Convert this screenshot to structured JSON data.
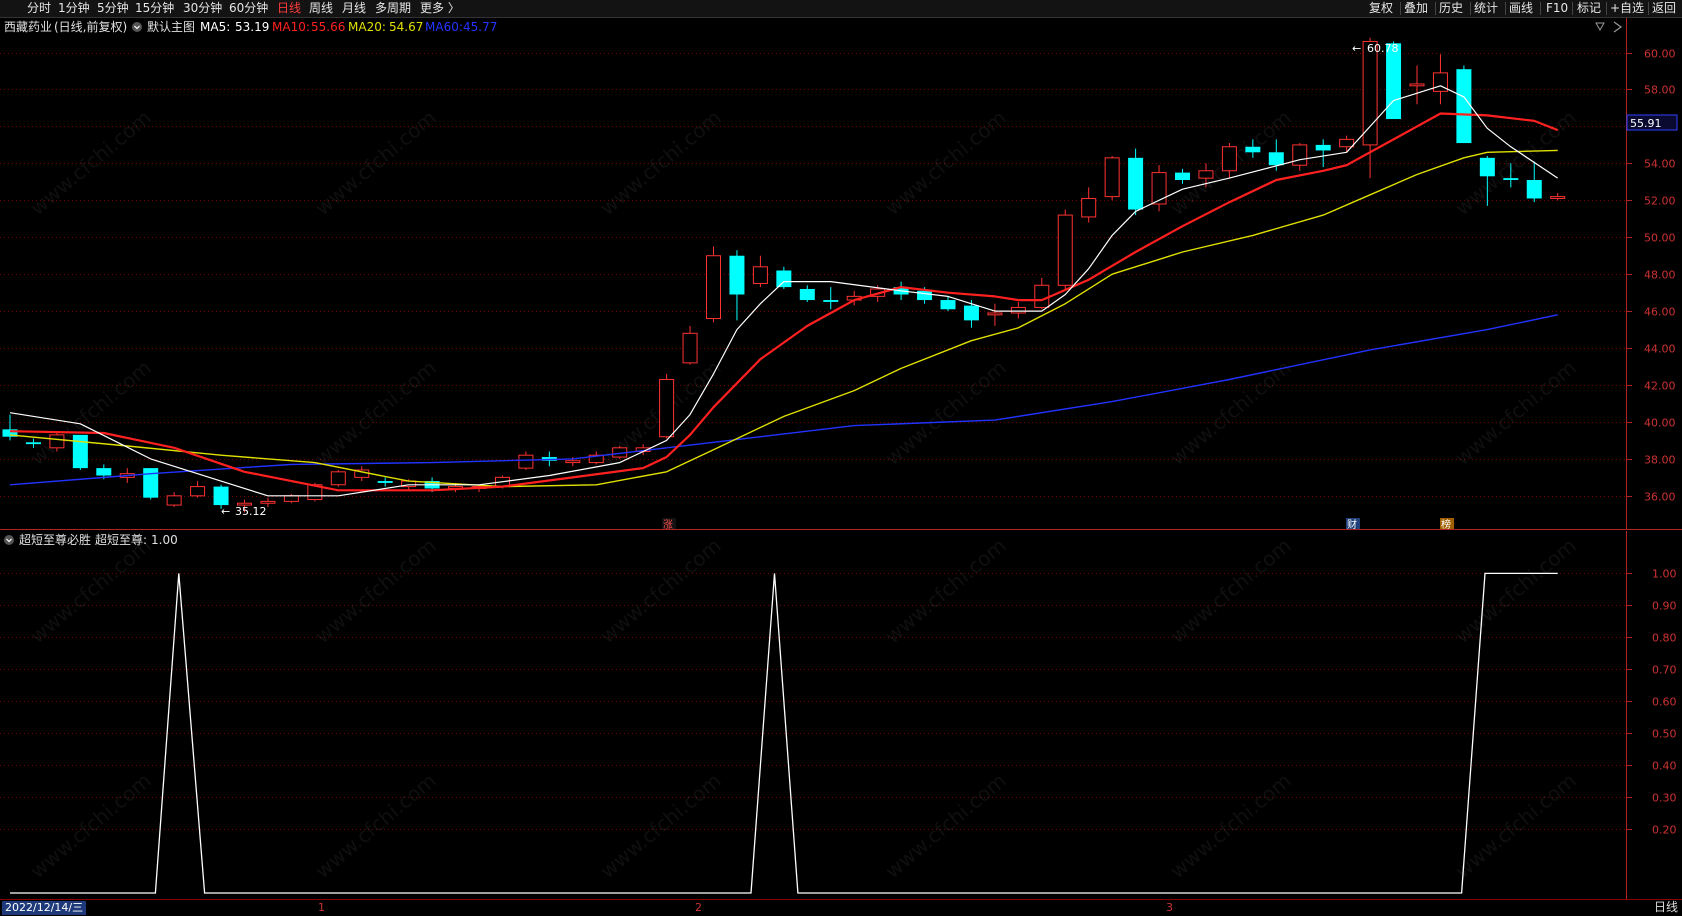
{
  "toolbar": {
    "left_items": [
      "分时",
      "1分钟",
      "5分钟",
      "15分钟",
      "30分钟",
      "60分钟",
      "日线",
      "周线",
      "月线",
      "多周期",
      "更多"
    ],
    "active_index": 6,
    "more_arrow": "〉",
    "right_items": [
      "复权",
      "叠加",
      "历史",
      "统计",
      "画线",
      "F10",
      "标记",
      "+自选",
      "返回"
    ]
  },
  "main_legend": {
    "stock_name": "西藏药业",
    "mode": "(日线,前复权)",
    "template": "默认主图",
    "ma5_label": "MA5:",
    "ma5_value": "53.19",
    "ma10_label": "MA10:",
    "ma10_value": "55.66",
    "ma20_label": "MA20:",
    "ma20_value": "54.67",
    "ma60_label": "MA60:",
    "ma60_value": "45.77"
  },
  "indicator_legend": {
    "name": "超短至尊必胜",
    "series_label": "超短至尊:",
    "series_value": "1.00"
  },
  "price_axis": {
    "ticks": [
      "60.00",
      "58.00",
      "56.00",
      "54.00",
      "52.00",
      "50.00",
      "48.00",
      "46.00",
      "44.00",
      "42.00",
      "40.00",
      "38.00",
      "36.00"
    ],
    "current_price": "55.91"
  },
  "indicator_axis": {
    "ticks": [
      "1.00",
      "0.90",
      "0.80",
      "0.70",
      "0.60",
      "0.50",
      "0.40",
      "0.30",
      "0.20"
    ]
  },
  "annotations": {
    "high_label": "60.78",
    "low_label": "35.12",
    "event_markers": [
      "涨",
      "财",
      "榜"
    ]
  },
  "bottom": {
    "date": "2022/12/14/三",
    "month_ticks": [
      "1",
      "2",
      "3"
    ],
    "period": "日线"
  },
  "watermark": "www.cfchi.com",
  "colors": {
    "up": "#ff3232",
    "down": "#00ffff",
    "ma5": "#ffffff",
    "ma10": "#ff2020",
    "ma20": "#e0e000",
    "ma60": "#2233ff",
    "grid": "#7a0000",
    "axis": "#b22222",
    "indicator": "#ffffff"
  },
  "chart_data": [
    {
      "type": "candlestick",
      "ylim": [
        34.8,
        61.6
      ],
      "ohlc": [
        [
          39.6,
          40.4,
          39.0,
          39.2
        ],
        [
          38.9,
          39.1,
          38.6,
          38.8
        ],
        [
          38.6,
          39.4,
          38.4,
          39.3
        ],
        [
          39.3,
          39.3,
          37.4,
          37.5
        ],
        [
          37.5,
          37.7,
          36.9,
          37.1
        ],
        [
          37.0,
          37.5,
          36.7,
          37.2
        ],
        [
          37.5,
          37.5,
          35.8,
          35.9
        ],
        [
          35.5,
          36.2,
          35.4,
          36.0
        ],
        [
          36.0,
          36.8,
          35.9,
          36.5
        ],
        [
          36.5,
          36.6,
          35.3,
          35.5
        ],
        [
          35.5,
          35.8,
          35.1,
          35.6
        ],
        [
          35.6,
          35.9,
          35.4,
          35.7
        ],
        [
          35.7,
          36.1,
          35.6,
          36.0
        ],
        [
          35.8,
          36.7,
          35.7,
          36.6
        ],
        [
          36.6,
          37.4,
          36.5,
          37.3
        ],
        [
          37.0,
          37.6,
          36.8,
          37.4
        ],
        [
          36.8,
          37.0,
          36.5,
          36.7
        ],
        [
          36.5,
          36.9,
          36.3,
          36.8
        ],
        [
          36.8,
          37.0,
          36.2,
          36.4
        ],
        [
          36.4,
          36.7,
          36.2,
          36.5
        ],
        [
          36.4,
          36.6,
          36.2,
          36.5
        ],
        [
          36.5,
          37.1,
          36.4,
          37.0
        ],
        [
          37.5,
          38.4,
          37.4,
          38.2
        ],
        [
          38.1,
          38.4,
          37.6,
          37.9
        ],
        [
          37.8,
          38.1,
          37.6,
          37.9
        ],
        [
          37.8,
          38.4,
          37.7,
          38.2
        ],
        [
          38.1,
          38.7,
          38.0,
          38.6
        ],
        [
          38.4,
          38.8,
          38.2,
          38.6
        ],
        [
          39.2,
          42.6,
          39.1,
          42.3
        ],
        [
          43.2,
          45.2,
          43.1,
          44.8
        ],
        [
          45.6,
          49.5,
          45.4,
          49.0
        ],
        [
          49.0,
          49.3,
          45.5,
          46.9
        ],
        [
          47.5,
          49.0,
          47.3,
          48.4
        ],
        [
          48.2,
          48.4,
          47.2,
          47.3
        ],
        [
          47.2,
          47.4,
          46.5,
          46.6
        ],
        [
          46.6,
          47.3,
          46.1,
          46.5
        ],
        [
          46.6,
          47.1,
          46.3,
          46.8
        ],
        [
          46.8,
          47.4,
          46.5,
          47.2
        ],
        [
          47.3,
          47.6,
          46.6,
          46.9
        ],
        [
          47.1,
          47.3,
          46.4,
          46.6
        ],
        [
          46.6,
          46.8,
          46.0,
          46.1
        ],
        [
          46.3,
          46.6,
          45.1,
          45.5
        ],
        [
          45.8,
          46.4,
          45.2,
          45.9
        ],
        [
          45.9,
          46.5,
          45.6,
          46.2
        ],
        [
          46.2,
          47.8,
          46.1,
          47.4
        ],
        [
          47.4,
          51.5,
          47.2,
          51.2
        ],
        [
          51.1,
          52.7,
          50.8,
          52.1
        ],
        [
          52.2,
          54.4,
          52.0,
          54.3
        ],
        [
          54.3,
          54.8,
          51.2,
          51.5
        ],
        [
          51.8,
          53.9,
          51.4,
          53.5
        ],
        [
          53.5,
          53.7,
          52.9,
          53.1
        ],
        [
          53.2,
          54.0,
          52.7,
          53.6
        ],
        [
          53.6,
          55.1,
          53.2,
          54.9
        ],
        [
          54.9,
          55.3,
          54.3,
          54.6
        ],
        [
          54.6,
          55.3,
          53.6,
          53.9
        ],
        [
          53.9,
          55.1,
          53.6,
          55.0
        ],
        [
          55.0,
          55.3,
          53.8,
          54.7
        ],
        [
          54.9,
          55.5,
          54.6,
          55.3
        ],
        [
          55.0,
          60.8,
          53.2,
          60.6
        ],
        [
          60.5,
          60.6,
          56.5,
          56.4
        ],
        [
          58.2,
          59.3,
          57.2,
          58.3
        ],
        [
          57.9,
          59.9,
          57.2,
          58.9
        ],
        [
          59.1,
          59.3,
          55.1,
          55.1
        ],
        [
          54.3,
          54.4,
          51.7,
          53.3
        ],
        [
          53.2,
          54.0,
          52.7,
          53.1
        ],
        [
          53.1,
          54.1,
          51.9,
          52.1
        ],
        [
          52.1,
          52.4,
          52.0,
          52.2
        ]
      ],
      "ma5": [
        [
          0,
          40.5
        ],
        [
          3,
          39.9
        ],
        [
          6,
          38.0
        ],
        [
          9,
          36.8
        ],
        [
          11,
          36.0
        ],
        [
          14,
          36.0
        ],
        [
          17,
          36.6
        ],
        [
          20,
          36.6
        ],
        [
          23,
          37.1
        ],
        [
          26,
          37.8
        ],
        [
          28,
          39.0
        ],
        [
          29,
          40.4
        ],
        [
          30,
          42.6
        ],
        [
          31,
          45.0
        ],
        [
          32,
          46.4
        ],
        [
          33,
          47.6
        ],
        [
          35,
          47.6
        ],
        [
          38,
          47.1
        ],
        [
          40,
          46.8
        ],
        [
          42,
          46.0
        ],
        [
          44,
          46.0
        ],
        [
          45,
          46.9
        ],
        [
          46,
          48.3
        ],
        [
          47,
          50.1
        ],
        [
          48,
          51.4
        ],
        [
          50,
          52.6
        ],
        [
          52,
          53.2
        ],
        [
          55,
          54.2
        ],
        [
          57,
          54.6
        ],
        [
          58,
          56.0
        ],
        [
          59,
          57.4
        ],
        [
          61,
          58.2
        ],
        [
          62,
          57.6
        ],
        [
          63,
          55.9
        ],
        [
          64,
          54.9
        ],
        [
          66,
          53.2
        ]
      ],
      "ma10": [
        [
          0,
          39.5
        ],
        [
          4,
          39.4
        ],
        [
          7,
          38.6
        ],
        [
          10,
          37.3
        ],
        [
          14,
          36.3
        ],
        [
          18,
          36.3
        ],
        [
          21,
          36.5
        ],
        [
          24,
          37.0
        ],
        [
          27,
          37.5
        ],
        [
          28,
          38.1
        ],
        [
          29,
          39.3
        ],
        [
          30,
          40.8
        ],
        [
          32,
          43.4
        ],
        [
          34,
          45.2
        ],
        [
          36,
          46.6
        ],
        [
          38,
          47.3
        ],
        [
          40,
          47.0
        ],
        [
          42,
          46.8
        ],
        [
          43,
          46.6
        ],
        [
          44,
          46.6
        ],
        [
          46,
          47.7
        ],
        [
          48,
          49.2
        ],
        [
          50,
          50.6
        ],
        [
          52,
          51.9
        ],
        [
          54,
          53.1
        ],
        [
          56,
          53.6
        ],
        [
          57,
          53.9
        ],
        [
          59,
          55.3
        ],
        [
          61,
          56.7
        ],
        [
          63,
          56.6
        ],
        [
          65,
          56.3
        ],
        [
          66,
          55.8
        ]
      ],
      "ma20": [
        [
          0,
          39.3
        ],
        [
          5,
          38.7
        ],
        [
          9,
          38.2
        ],
        [
          13,
          37.8
        ],
        [
          17,
          36.8
        ],
        [
          21,
          36.5
        ],
        [
          25,
          36.6
        ],
        [
          28,
          37.3
        ],
        [
          30,
          38.5
        ],
        [
          33,
          40.3
        ],
        [
          36,
          41.7
        ],
        [
          38,
          42.9
        ],
        [
          41,
          44.4
        ],
        [
          43,
          45.1
        ],
        [
          45,
          46.4
        ],
        [
          47,
          48.0
        ],
        [
          50,
          49.2
        ],
        [
          53,
          50.1
        ],
        [
          56,
          51.2
        ],
        [
          58,
          52.3
        ],
        [
          60,
          53.4
        ],
        [
          62,
          54.3
        ],
        [
          63,
          54.6
        ],
        [
          66,
          54.7
        ]
      ],
      "ma60": [
        [
          0,
          36.6
        ],
        [
          6,
          37.2
        ],
        [
          12,
          37.7
        ],
        [
          18,
          37.8
        ],
        [
          24,
          38.0
        ],
        [
          30,
          38.9
        ],
        [
          36,
          39.8
        ],
        [
          42,
          40.1
        ],
        [
          47,
          41.1
        ],
        [
          52,
          42.3
        ],
        [
          58,
          43.9
        ],
        [
          63,
          45.0
        ],
        [
          66,
          45.8
        ]
      ]
    },
    {
      "type": "line",
      "name": "超短至尊",
      "ylim": [
        0,
        1.07
      ],
      "x": [
        0,
        6.2,
        7.2,
        8.3,
        31.6,
        32.6,
        33.6,
        61.9,
        62.9,
        66
      ],
      "y": [
        0,
        0,
        1,
        0,
        0,
        1,
        0,
        0,
        1,
        1
      ]
    }
  ]
}
